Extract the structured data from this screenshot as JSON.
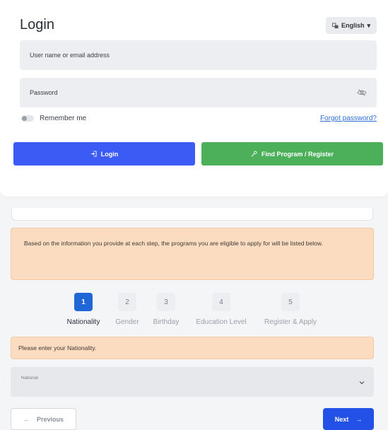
{
  "login": {
    "title": "Login",
    "language": "English",
    "username_placeholder": "User name or email address",
    "password_placeholder": "Password",
    "remember_label": "Remember me",
    "forgot_label": "Forgot password?",
    "login_button": "Login",
    "register_button": "Find Program / Register"
  },
  "info": {
    "message": "Based on the information you provide at each step, the programs you are eligible to apply for will be listed below."
  },
  "steps": [
    {
      "number": "1",
      "label": "Nationality",
      "active": true
    },
    {
      "number": "2",
      "label": "Gender",
      "active": false
    },
    {
      "number": "3",
      "label": "Birthday",
      "active": false
    },
    {
      "number": "4",
      "label": "Education Level",
      "active": false
    },
    {
      "number": "5",
      "label": "Register & Apply",
      "active": false
    }
  ],
  "warning": {
    "message": "Please enter your Nationality."
  },
  "nationality_select": {
    "placeholder": "National"
  },
  "nav": {
    "previous": "Previous",
    "next": "Next"
  },
  "colors": {
    "login_button": "#3b5bf4",
    "register_button": "#4caf5a",
    "active_step": "#2166d6",
    "alert_background": "#fbdcc1",
    "next_button": "#2350e6"
  },
  "icons": {
    "language": "language-icon",
    "password_visibility": "eye-off-icon",
    "login": "login-arrow-icon",
    "register": "key-icon",
    "select": "chevron-down-icon",
    "previous": "arrow-left-icon",
    "next": "arrow-right-icon"
  }
}
